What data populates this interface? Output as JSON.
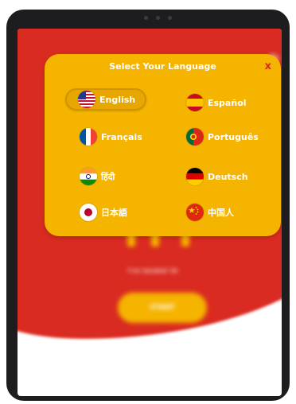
{
  "modal": {
    "title": "Select Your Language",
    "close_label": "x"
  },
  "languages": [
    {
      "label": "English",
      "flag": "us-flag-icon",
      "selected": true
    },
    {
      "label": "Español",
      "flag": "spain-flag-icon",
      "selected": false
    },
    {
      "label": "Français",
      "flag": "france-flag-icon",
      "selected": false
    },
    {
      "label": "Português",
      "flag": "portugal-flag-icon",
      "selected": false
    },
    {
      "label": "हिंदी",
      "flag": "india-flag-icon",
      "selected": false
    },
    {
      "label": "Deutsch",
      "flag": "germany-flag-icon",
      "selected": false
    },
    {
      "label": "日本語",
      "flag": "japan-flag-icon",
      "selected": false
    },
    {
      "label": "中国人",
      "flag": "china-flag-icon",
      "selected": false
    }
  ],
  "background": {
    "tagline": "I've landed 1k",
    "start_button": "START"
  },
  "colors": {
    "accent_yellow": "#f5b400",
    "brand_red": "#d92b21",
    "device_frame": "#1d1d1f"
  }
}
